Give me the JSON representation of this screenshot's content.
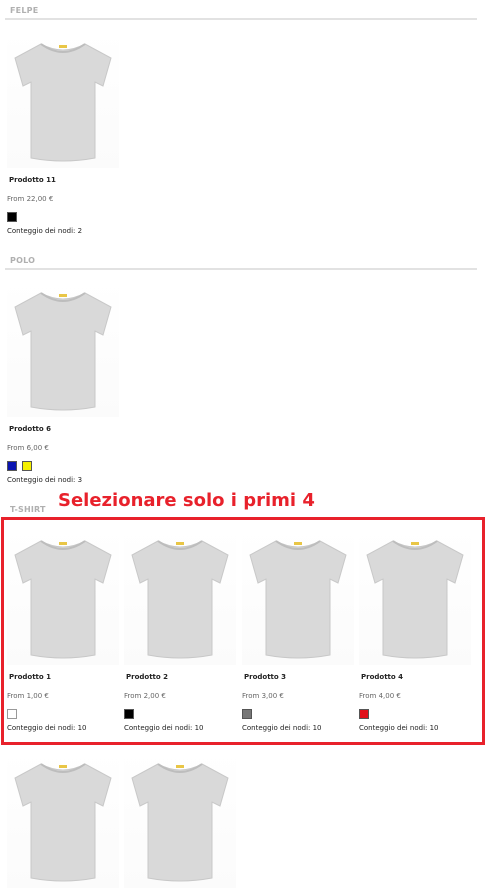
{
  "sections": [
    {
      "title": "FELPE",
      "products": [
        {
          "name": "Prodotto 11",
          "price": "From 22,00 €",
          "swatches": [
            "#000000"
          ],
          "node_count": "Conteggio dei nodi: 2"
        }
      ]
    },
    {
      "title": "POLO",
      "products": [
        {
          "name": "Prodotto 6",
          "price": "From 6,00 €",
          "swatches": [
            "#0a14b0",
            "#f5f000"
          ],
          "node_count": "Conteggio dei nodi: 3"
        }
      ]
    },
    {
      "title": "T-SHIRT",
      "products": [
        {
          "name": "Prodotto 1",
          "price": "From 1,00 €",
          "swatches": [
            "#ffffff"
          ],
          "node_count": "Conteggio dei nodi: 10"
        },
        {
          "name": "Prodotto 2",
          "price": "From 2,00 €",
          "swatches": [
            "#000000"
          ],
          "node_count": "Conteggio dei nodi: 10"
        },
        {
          "name": "Prodotto 3",
          "price": "From 3,00 €",
          "swatches": [
            "#777777"
          ],
          "node_count": "Conteggio dei nodi: 10"
        },
        {
          "name": "Prodotto 4",
          "price": "From 4,00 €",
          "swatches": [
            "#e0101a"
          ],
          "node_count": "Conteggio dei nodi: 10"
        }
      ]
    }
  ],
  "annotation": {
    "text": "Selezionare solo i primi 4",
    "color": "#e8212b"
  },
  "icons": {
    "product_image": "tshirt-icon"
  }
}
